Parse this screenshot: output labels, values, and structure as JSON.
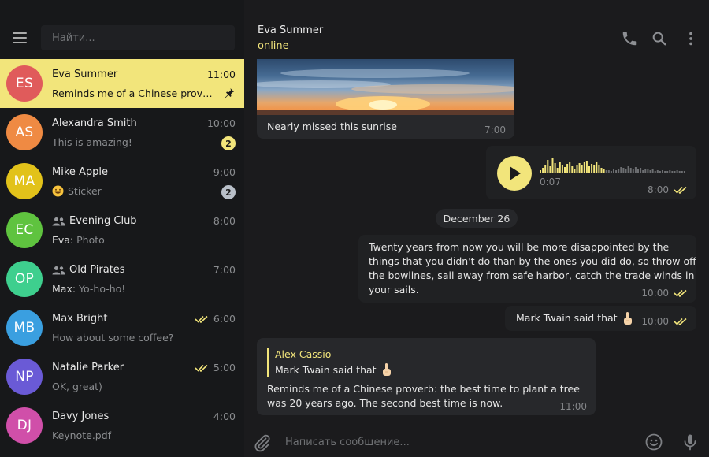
{
  "search": {
    "placeholder": "Найти..."
  },
  "chats": [
    {
      "initials": "ES",
      "name": "Eva Summer",
      "time": "11:00",
      "preview": "Reminds me of a Chinese proverb: the best time to plant a tree",
      "avatar_color": "#e05b5b",
      "pinned": true,
      "active": true
    },
    {
      "initials": "AS",
      "name": "Alexandra Smith",
      "time": "10:00",
      "preview": "This is amazing!",
      "avatar_color": "#ef8a43",
      "unread": "2",
      "badge_color": "#f2e57b"
    },
    {
      "initials": "MA",
      "name": "Mike Apple",
      "time": "9:00",
      "preview": "Sticker",
      "avatar_color": "#e2c21a",
      "unread": "2",
      "badge_color": "#b9c0c9",
      "preview_emoji": "grinning-emoji"
    },
    {
      "initials": "EC",
      "name": "Evening Club",
      "time": "8:00",
      "preview_sender": "Eva:",
      "preview": " Photo",
      "avatar_color": "#5fc33f",
      "group": true
    },
    {
      "initials": "OP",
      "name": "Old Pirates",
      "time": "7:00",
      "preview_sender": "Max:",
      "preview": " Yo-ho-ho!",
      "avatar_color": "#3ecf8e",
      "group": true
    },
    {
      "initials": "MB",
      "name": "Max Bright",
      "time": "6:00",
      "preview": "How about some coffee?",
      "avatar_color": "#3a9fe0",
      "read": true
    },
    {
      "initials": "NP",
      "name": "Natalie Parker",
      "time": "5:00",
      "preview": "OK, great)",
      "avatar_color": "#6a5ad6",
      "read": true
    },
    {
      "initials": "DJ",
      "name": "Davy Jones",
      "time": "4:00",
      "preview": "Keynote.pdf",
      "avatar_color": "#d04fa9"
    }
  ],
  "header": {
    "name": "Eva Summer",
    "status": "online"
  },
  "messages": {
    "photo_caption": "Nearly missed this sunrise",
    "photo_time": "7:00",
    "voice_duration": "0:07",
    "voice_time": "8:00",
    "voice_waveform": [
      3,
      6,
      10,
      16,
      8,
      18,
      12,
      6,
      14,
      9,
      7,
      11,
      13,
      8,
      5,
      10,
      12,
      9,
      13,
      15,
      8,
      11,
      9,
      14,
      10,
      6,
      4,
      3,
      3,
      2,
      4,
      3,
      5,
      7,
      6,
      5,
      8,
      6,
      4,
      7,
      5,
      6,
      3,
      4,
      5,
      3,
      4,
      2,
      3,
      2,
      3,
      2,
      2,
      3,
      2,
      2,
      3,
      2,
      2,
      2
    ],
    "date_divider": "December 26",
    "long_quote_lines": [
      "Twenty years from now you will be more disappointed by the",
      "things that you didn't do than by the ones you did do, so throw off",
      "the bowlines, sail away from safe harbor, catch the trade winds in",
      "your sails."
    ],
    "long_quote_time": "10:00",
    "twain_text": "Mark Twain said that",
    "twain_time": "10:00",
    "reply_name": "Alex Cassio",
    "reply_text": "Mark Twain said that",
    "proverb_lines": [
      "Reminds me of a Chinese proverb: the best time to plant a tree",
      "was 20 years ago. The second best time is now."
    ],
    "proverb_time": "11:00"
  },
  "composer": {
    "placeholder": "Написать сообщение..."
  },
  "colors": {
    "accent": "#f2e57b",
    "sidebar_bg": "#17181a",
    "chat_bg": "#1b1b1d",
    "bubble_in": "#27282b",
    "bubble_out": "#202123"
  }
}
